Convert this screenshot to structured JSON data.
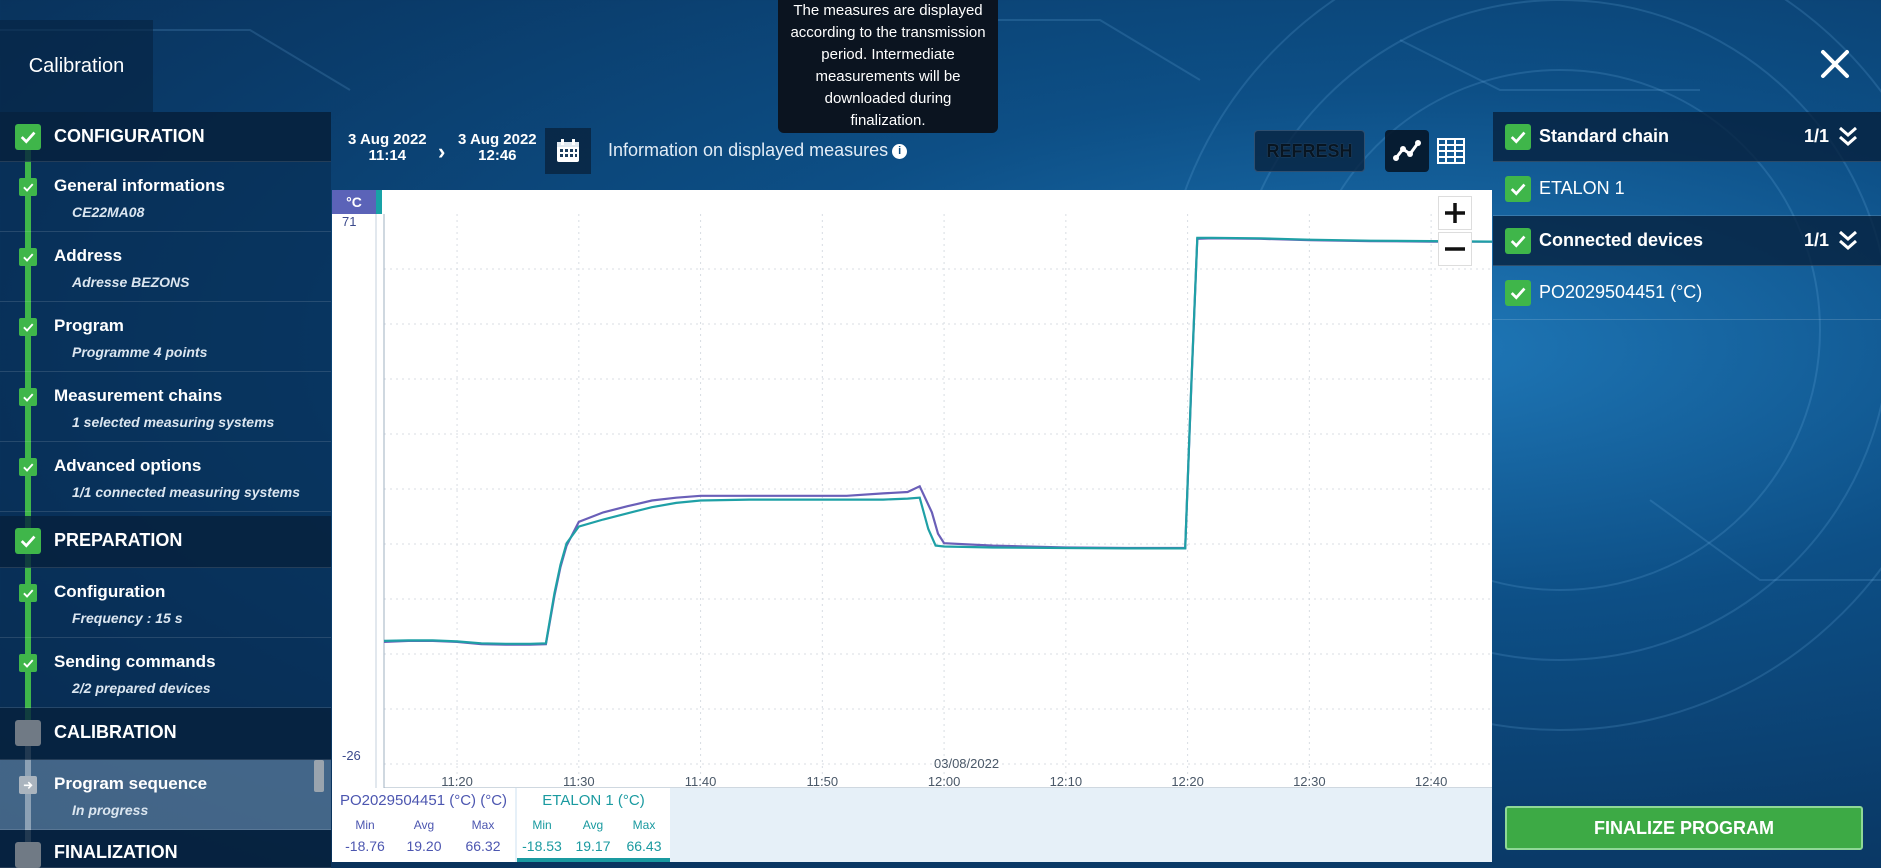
{
  "header": {
    "title": "Calibration",
    "close_icon": "close-icon"
  },
  "tooltip": {
    "lines": [
      "The measures are displayed",
      "according to the transmission",
      "period. Intermediate",
      "measurements will be",
      "downloaded during",
      "finalization."
    ]
  },
  "sidebar": {
    "sections": [
      {
        "title": "CONFIGURATION",
        "status": "done"
      },
      {
        "title": "PREPARATION",
        "status": "done"
      },
      {
        "title": "CALIBRATION",
        "status": "pending"
      },
      {
        "title": "FINALIZATION",
        "status": "pending"
      }
    ],
    "items": [
      {
        "title": "General informations",
        "desc": "CE22MA08"
      },
      {
        "title": "Address",
        "desc": "Adresse BEZONS"
      },
      {
        "title": "Program",
        "desc": "Programme 4 points"
      },
      {
        "title": "Measurement chains",
        "desc": "1 selected measuring systems"
      },
      {
        "title": "Advanced options",
        "desc": "1/1 connected measuring systems"
      },
      {
        "title": "Configuration",
        "desc": "Frequency : 15 s"
      },
      {
        "title": "Sending commands",
        "desc": "2/2 prepared devices"
      },
      {
        "title": "Program sequence",
        "desc": "In progress"
      }
    ]
  },
  "toolbar": {
    "start_date": "3 Aug 2022",
    "start_time": "11:14",
    "end_date": "3 Aug 2022",
    "end_time": "12:46",
    "info_label": "Information on displayed measures",
    "refresh_label": "REFRESH"
  },
  "chart_data": {
    "type": "line",
    "unit_label": "°C",
    "y_top_label": "71",
    "y_bottom_label": "-26",
    "ylim": [
      -26,
      71
    ],
    "date_label": "03/08/2022",
    "x_ticks": [
      "11:20",
      "11:30",
      "11:40",
      "11:50",
      "12:00",
      "12:10",
      "12:20",
      "12:30",
      "12:40"
    ],
    "x_minutes": [
      20,
      30,
      40,
      50,
      60,
      70,
      80,
      90,
      100
    ],
    "xlim": [
      14,
      105
    ],
    "grid": true,
    "series": [
      {
        "name": "PO2029504451 (°C)",
        "color": "#6a5fb8",
        "x": [
          14,
          16,
          18,
          20,
          22,
          24,
          26,
          27.3,
          28,
          28.5,
          29,
          30,
          32,
          34,
          36,
          38,
          40,
          44,
          48,
          52,
          55,
          57,
          58,
          59,
          59.5,
          60,
          64,
          70,
          75,
          79.8,
          80.3,
          80.8,
          82,
          86,
          90,
          95,
          100,
          105
        ],
        "y": [
          -18.8,
          -18.6,
          -18.6,
          -18.8,
          -19.3,
          -19.4,
          -19.4,
          -19.3,
          -9.0,
          -3.0,
          1.5,
          6.5,
          8.5,
          9.8,
          11.0,
          11.6,
          12.0,
          12.0,
          12.0,
          12.0,
          12.5,
          12.8,
          14.0,
          8.5,
          4.0,
          2.0,
          1.5,
          1.1,
          1.0,
          1.0,
          35.0,
          66.2,
          66.3,
          66.2,
          65.9,
          65.7,
          65.6,
          65.6
        ]
      },
      {
        "name": "ETALON 1",
        "color": "#1fa0a6",
        "x": [
          14,
          16,
          18,
          20,
          22,
          24,
          26,
          27.3,
          28,
          28.5,
          29,
          30,
          32,
          34,
          36,
          38,
          40,
          44,
          48,
          52,
          55,
          57,
          58,
          58.7,
          59.3,
          60,
          64,
          70,
          75,
          79.8,
          80.3,
          80.8,
          82,
          86,
          90,
          95,
          100,
          105
        ],
        "y": [
          -18.6,
          -18.5,
          -18.5,
          -18.7,
          -19.1,
          -19.2,
          -19.2,
          -19.1,
          -8.5,
          -2.5,
          2.0,
          5.5,
          7.0,
          8.3,
          9.6,
          10.5,
          11.0,
          11.2,
          11.2,
          11.2,
          11.2,
          11.4,
          11.6,
          5.0,
          1.5,
          1.3,
          1.1,
          1.0,
          0.9,
          0.9,
          35.5,
          66.4,
          66.4,
          66.3,
          66.0,
          65.8,
          65.7,
          65.6
        ]
      }
    ]
  },
  "stats": [
    {
      "title": "PO2029504451 (°C) (°C)",
      "color": "#4c56b0",
      "min_label": "Min",
      "avg_label": "Avg",
      "max_label": "Max",
      "min": "-18.76",
      "avg": "19.20",
      "max": "66.32"
    },
    {
      "title": "ETALON 1 (°C)",
      "color": "#1a9aa0",
      "min_label": "Min",
      "avg_label": "Avg",
      "max_label": "Max",
      "min": "-18.53",
      "avg": "19.17",
      "max": "66.43"
    }
  ],
  "right_panel": {
    "standard_chain": {
      "label": "Standard chain",
      "count": "1/1"
    },
    "standard_item": "ETALON 1",
    "connected_devices": {
      "label": "Connected devices",
      "count": "1/1"
    },
    "device_item": "PO2029504451 (°C)"
  },
  "finalize_label": "FINALIZE PROGRAM",
  "colors": {
    "accent_green": "#3fb64a",
    "series1": "#6a5fb8",
    "series2": "#1fa0a6",
    "unit_badge": "#5b63b8"
  }
}
